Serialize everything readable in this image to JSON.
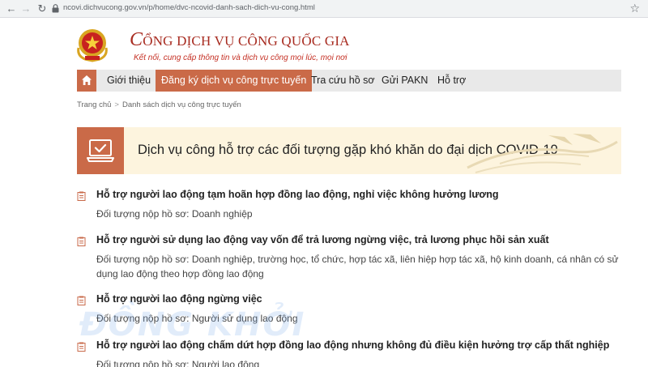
{
  "browser": {
    "url": "ncovi.dichvucong.gov.vn/p/home/dvc-ncovid-danh-sach-dich-vu-cong.html"
  },
  "header": {
    "title_first_letter": "C",
    "title_rest": "ỔNG DỊCH VỤ CÔNG QUỐC GIA",
    "tagline": "Kết nối, cung cấp thông tin và dịch vụ công mọi lúc, mọi nơi"
  },
  "nav": {
    "items": [
      {
        "label": "Giới thiệu"
      },
      {
        "label": "Đăng ký dịch vụ công trực tuyến"
      },
      {
        "label": "Tra cứu hồ sơ"
      },
      {
        "label": "Gửi PAKN"
      },
      {
        "label": "Hỗ trợ"
      }
    ]
  },
  "breadcrumb": {
    "home": "Trang chủ",
    "current": "Danh sách dịch vụ công trực tuyến"
  },
  "banner": {
    "title": "Dịch vụ công hỗ trợ các đối tượng gặp khó khăn do đại dịch COVID-19"
  },
  "services": [
    {
      "title": "Hỗ trợ người lao động tạm hoãn hợp đồng lao động, nghỉ việc không hưởng lương",
      "subject": "Đối tượng nộp hồ sơ: Doanh nghiệp"
    },
    {
      "title": "Hỗ trợ người sử dụng lao động vay vốn để trả lương ngừng việc, trả lương phục hồi sản xuất",
      "subject": "Đối tượng nộp hồ sơ: Doanh nghiệp, trường học, tổ chức, hợp tác xã, liên hiệp hợp tác xã, hộ kinh doanh, cá nhân có sử dụng lao động theo hợp đồng lao động"
    },
    {
      "title": "Hỗ trợ người lao động ngừng việc",
      "subject": "Đối tượng nộp hồ sơ: Người sử dụng lao động"
    },
    {
      "title": "Hỗ trợ người lao động chấm dứt hợp đồng lao động nhưng không đủ điều kiện hưởng trợ cấp thất nghiệp",
      "subject": "Đối tượng nộp hồ sơ: Người lao động"
    }
  ],
  "watermark": "ĐỒNG KHỞI",
  "colors": {
    "accent": "#ca6a48",
    "title_red": "#a82c21",
    "banner_bg": "#fdf4de",
    "nav_bg": "#e9e9e9"
  }
}
